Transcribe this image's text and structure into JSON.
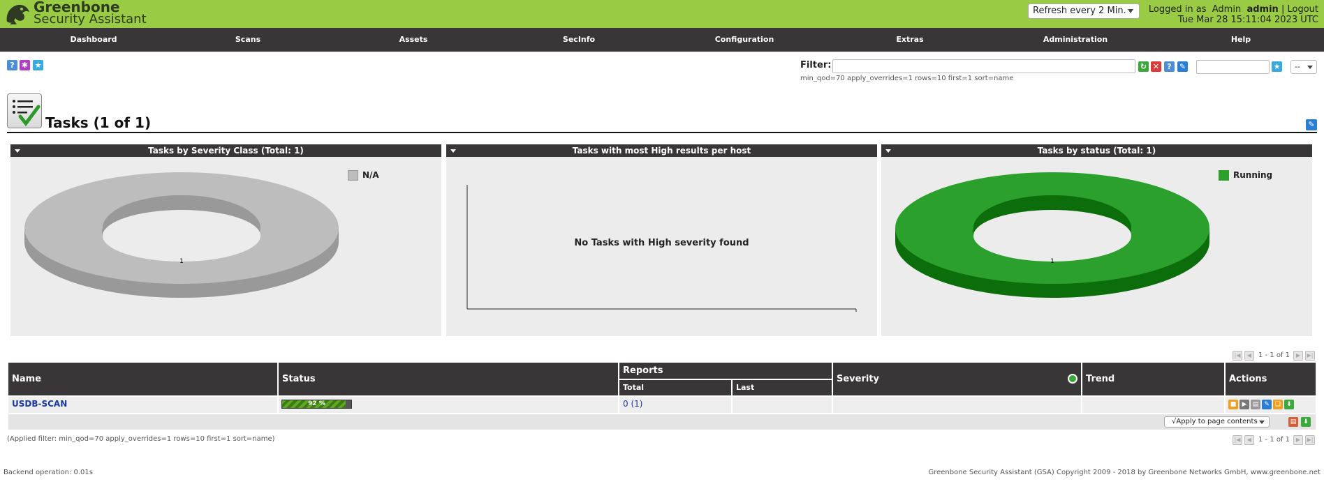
{
  "header": {
    "brand_line1": "Greenbone",
    "brand_line2": "Security Assistant",
    "refresh_select": "Refresh every 2 Min.",
    "logged_in_as": "Logged in as",
    "role": "Admin",
    "username": "admin",
    "separator": "|",
    "logout": "Logout",
    "datetime": "Tue Mar 28 15:11:04 2023 UTC"
  },
  "nav": {
    "items": [
      "Dashboard",
      "Scans",
      "Assets",
      "SecInfo",
      "Configuration",
      "Extras",
      "Administration",
      "Help"
    ]
  },
  "toolbar": {
    "icons": [
      "help-icon",
      "new-task-wizard-icon",
      "new-task-icon"
    ]
  },
  "filter": {
    "label": "Filter:",
    "value": "",
    "filter_string": "min_qod=70 apply_overrides=1 rows=10 first=1 sort=name",
    "icons": [
      "refresh-icon",
      "delete-filter-icon",
      "help-icon",
      "edit-filter-icon"
    ],
    "name_value": "",
    "select_value": "--"
  },
  "page": {
    "title": "Tasks (1 of 1)"
  },
  "panels": [
    {
      "title": "Tasks by Severity Class (Total: 1)",
      "legend": [
        {
          "label": "N/A",
          "color": "#bdbdbd"
        }
      ],
      "chart_data": {
        "type": "pie",
        "categories": [
          "N/A"
        ],
        "values": [
          1
        ]
      }
    },
    {
      "title": "Tasks with most High results per host",
      "message": "No Tasks with High severity found"
    },
    {
      "title": "Tasks by status (Total: 1)",
      "legend": [
        {
          "label": "Running",
          "color": "#2ca02c"
        }
      ],
      "chart_data": {
        "type": "pie",
        "categories": [
          "Running"
        ],
        "values": [
          1
        ]
      }
    }
  ],
  "pagination": {
    "text": "1 - 1 of 1"
  },
  "table": {
    "headers": {
      "name": "Name",
      "status": "Status",
      "reports": "Reports",
      "total": "Total",
      "last": "Last",
      "severity": "Severity",
      "trend": "Trend",
      "actions": "Actions"
    },
    "rows": [
      {
        "name": "USDB-SCAN",
        "progress_label": "92 %",
        "progress": 0.92,
        "reports_total": "0 (1)",
        "reports_last": "",
        "severity": "",
        "trend": ""
      }
    ],
    "bulk_action": "√Apply to page contents"
  },
  "applied_filter": "(Applied filter: min_qod=70 apply_overrides=1 rows=10 first=1 sort=name)",
  "footer": {
    "backend": "Backend operation: 0.01s",
    "copyright": "Greenbone Security Assistant (GSA) Copyright 2009 - 2018 by Greenbone Networks GmbH, www.greenbone.net"
  }
}
